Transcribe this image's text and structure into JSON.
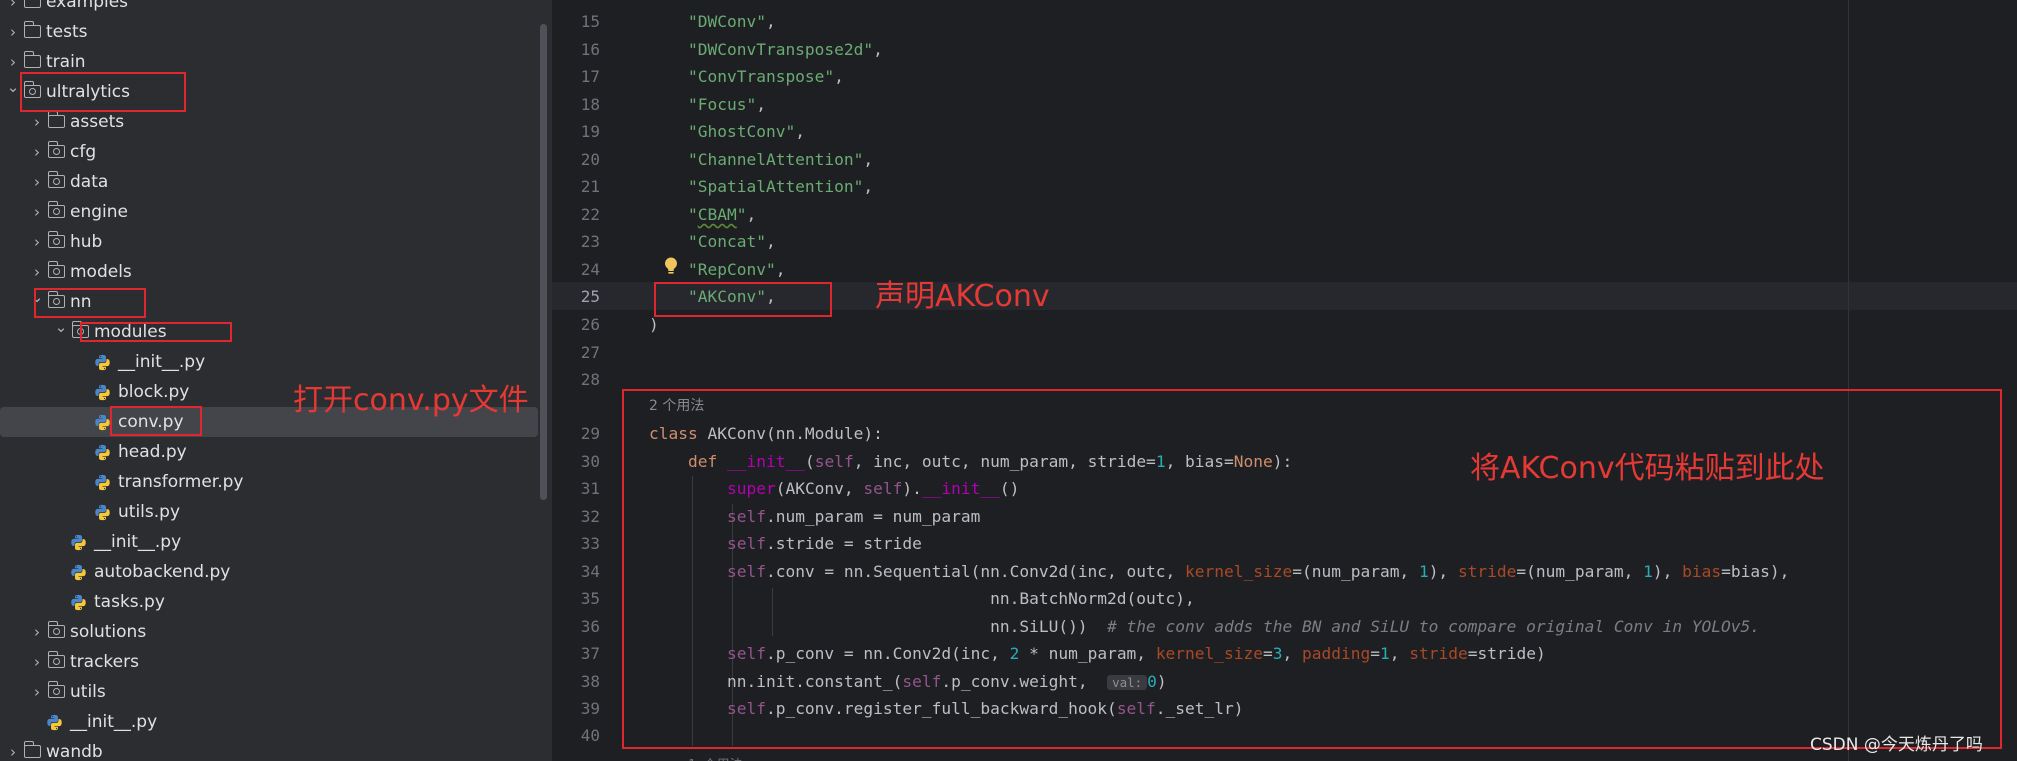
{
  "project_tree": {
    "items": [
      {
        "label": "examples",
        "kind": "folder",
        "expandable": true,
        "expanded": false
      },
      {
        "label": "tests",
        "kind": "folder",
        "expandable": true,
        "expanded": false
      },
      {
        "label": "train",
        "kind": "folder",
        "expandable": true,
        "expanded": false
      },
      {
        "label": "ultralytics",
        "kind": "package",
        "expandable": true,
        "expanded": true
      },
      {
        "label": "assets",
        "kind": "folder",
        "expandable": true,
        "expanded": false
      },
      {
        "label": "cfg",
        "kind": "package",
        "expandable": true,
        "expanded": false
      },
      {
        "label": "data",
        "kind": "package",
        "expandable": true,
        "expanded": false
      },
      {
        "label": "engine",
        "kind": "package",
        "expandable": true,
        "expanded": false
      },
      {
        "label": "hub",
        "kind": "package",
        "expandable": true,
        "expanded": false
      },
      {
        "label": "models",
        "kind": "package",
        "expandable": true,
        "expanded": false
      },
      {
        "label": "nn",
        "kind": "package",
        "expandable": true,
        "expanded": true
      },
      {
        "label": "modules",
        "kind": "package",
        "expandable": true,
        "expanded": true
      },
      {
        "label": "__init__.py",
        "kind": "python"
      },
      {
        "label": "block.py",
        "kind": "python"
      },
      {
        "label": "conv.py",
        "kind": "python",
        "selected": true
      },
      {
        "label": "head.py",
        "kind": "python"
      },
      {
        "label": "transformer.py",
        "kind": "python"
      },
      {
        "label": "utils.py",
        "kind": "python"
      },
      {
        "label": "__init__.py",
        "kind": "python"
      },
      {
        "label": "autobackend.py",
        "kind": "python"
      },
      {
        "label": "tasks.py",
        "kind": "python"
      },
      {
        "label": "solutions",
        "kind": "package",
        "expandable": true,
        "expanded": false
      },
      {
        "label": "trackers",
        "kind": "package",
        "expandable": true,
        "expanded": false
      },
      {
        "label": "utils",
        "kind": "package",
        "expandable": true,
        "expanded": false
      },
      {
        "label": "__init__.py",
        "kind": "python"
      },
      {
        "label": "wandb",
        "kind": "folder",
        "expandable": true,
        "expanded": false
      }
    ]
  },
  "annotations": {
    "open_file": "打开conv.py文件",
    "declare": "声明AKConv",
    "paste_here": "将AKConv代码粘贴到此处"
  },
  "editor": {
    "current_line": "25",
    "usage_hint": "2 个用法",
    "inlay_hint": "val:",
    "line_numbers": [
      "15",
      "16",
      "17",
      "18",
      "19",
      "20",
      "21",
      "22",
      "23",
      "24",
      "25",
      "26",
      "27",
      "28",
      "29",
      "30",
      "31",
      "32",
      "33",
      "34",
      "35",
      "36",
      "37",
      "38",
      "39",
      "40"
    ],
    "strings": [
      "\"DWConv\"",
      "\"DWConvTranspose2d\"",
      "\"ConvTranspose\"",
      "\"Focus\"",
      "\"GhostConv\"",
      "\"ChannelAttention\"",
      "\"SpatialAttention\"",
      "\"CBAM\"",
      "\"Concat\"",
      "\"RepConv\"",
      "\"AKConv\""
    ],
    "comment": "# the conv adds the BN and SiLU to compare original Conv in YOLOv5."
  },
  "watermark": "CSDN @今天炼丹了吗",
  "colors": {
    "annotation_red": "#e0262e",
    "sidebar_bg": "#2b2d30",
    "editor_bg": "#1e1f22",
    "string": "#6aab73",
    "keyword": "#cf8e6d",
    "number": "#2aacb8"
  }
}
